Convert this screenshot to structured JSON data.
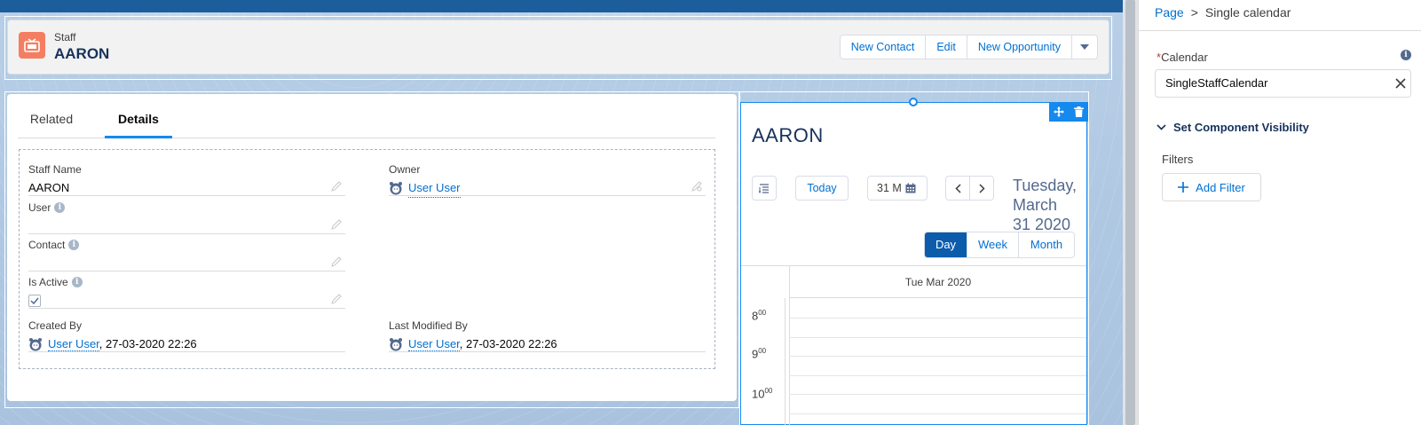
{
  "record": {
    "object_type": "Staff",
    "name": "AARON",
    "actions": [
      "New Contact",
      "Edit",
      "New Opportunity"
    ]
  },
  "tabs": [
    "Related",
    "Details"
  ],
  "fields": {
    "staff_name": {
      "label": "Staff Name",
      "value": "AARON"
    },
    "owner": {
      "label": "Owner",
      "value": "User User"
    },
    "user": {
      "label": "User",
      "value": ""
    },
    "contact": {
      "label": "Contact",
      "value": ""
    },
    "is_active": {
      "label": "Is Active",
      "checked": true
    },
    "created_by": {
      "label": "Created By",
      "user": "User User",
      "date": ", 27-03-2020 22:26"
    },
    "last_modified_by": {
      "label": "Last Modified By",
      "user": "User User",
      "date": ", 27-03-2020 22:26"
    }
  },
  "calendar": {
    "title": "AARON",
    "today_label": "Today",
    "date_input": "31 M",
    "date_line1": "Tuesday,",
    "date_line2": "March",
    "date_line3": "31 2020",
    "views": [
      "Day",
      "Week",
      "Month"
    ],
    "active_view": "Day",
    "day_header": "Tue Mar 2020",
    "time_slots": [
      {
        "hour": "8",
        "min": "00"
      },
      {
        "hour": "9",
        "min": "00"
      },
      {
        "hour": "10",
        "min": "00"
      }
    ]
  },
  "panel": {
    "breadcrumb": [
      "Page",
      "Single calendar"
    ],
    "calendar_label": "Calendar",
    "required_mark": "*",
    "calendar_value": "SingleStaffCalendar",
    "visibility_heading": "Set Component Visibility",
    "filters_label": "Filters",
    "add_filter_label": "Add Filter"
  },
  "colors": {
    "accent": "#1589ee",
    "brand_blue": "#0070d2",
    "object_icon": "#f47e61",
    "active_view": "#0b5cab"
  }
}
